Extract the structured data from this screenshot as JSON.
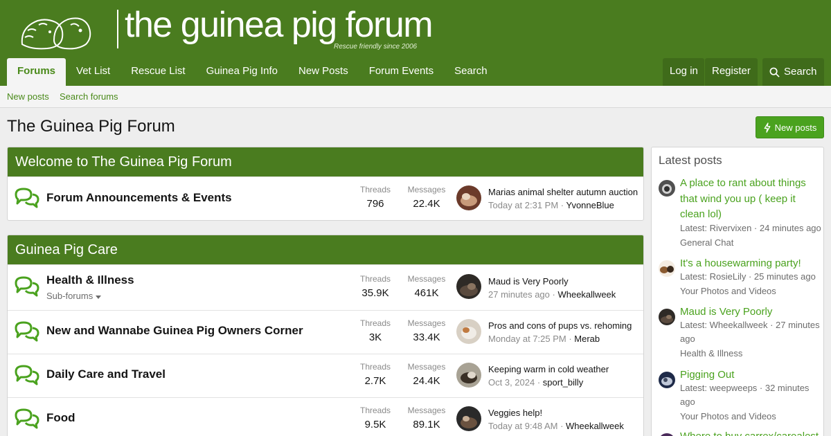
{
  "header": {
    "logo_text": "the guinea pig forum",
    "tagline": "Rescue friendly since 2006",
    "nav": [
      {
        "label": "Forums"
      },
      {
        "label": "Vet List"
      },
      {
        "label": "Rescue List"
      },
      {
        "label": "Guinea Pig Info"
      },
      {
        "label": "New Posts"
      },
      {
        "label": "Forum Events"
      },
      {
        "label": "Search"
      }
    ],
    "login": "Log in",
    "register": "Register",
    "search": "Search"
  },
  "subnav": {
    "new_posts": "New posts",
    "search_forums": "Search forums"
  },
  "page": {
    "title": "The Guinea Pig Forum",
    "new_posts_button": "New posts"
  },
  "categories": [
    {
      "title": "Welcome to The Guinea Pig Forum",
      "nodes": [
        {
          "title": "Forum Announcements & Events",
          "threads_label": "Threads",
          "threads": "796",
          "messages_label": "Messages",
          "messages": "22.4K",
          "last_title": "Marias animal shelter autumn auction",
          "last_date": "Today at 2:31 PM",
          "last_user": "YvonneBlue"
        }
      ]
    },
    {
      "title": "Guinea Pig Care",
      "nodes": [
        {
          "title": "Health & Illness",
          "subforums": "Sub-forums",
          "threads_label": "Threads",
          "threads": "35.9K",
          "messages_label": "Messages",
          "messages": "461K",
          "last_title": "Maud is Very Poorly",
          "last_date": "27 minutes ago",
          "last_user": "Wheekallweek"
        },
        {
          "title": "New and Wannabe Guinea Pig Owners Corner",
          "threads_label": "Threads",
          "threads": "3K",
          "messages_label": "Messages",
          "messages": "33.4K",
          "last_title": "Pros and cons of pups vs. rehoming",
          "last_date": "Monday at 7:25 PM",
          "last_user": "Merab"
        },
        {
          "title": "Daily Care and Travel",
          "threads_label": "Threads",
          "threads": "2.7K",
          "messages_label": "Messages",
          "messages": "24.4K",
          "last_title": "Keeping warm in cold weather",
          "last_date": "Oct 3, 2024",
          "last_user": "sport_billy"
        },
        {
          "title": "Food",
          "threads_label": "Threads",
          "threads": "9.5K",
          "messages_label": "Messages",
          "messages": "89.1K",
          "last_title": "Veggies help!",
          "last_date": "Today at 9:48 AM",
          "last_user": "Wheekallweek"
        }
      ]
    }
  ],
  "sidebar": {
    "title": "Latest posts",
    "posts": [
      {
        "title": "A place to rant about things that wind you up ( keep it clean lol)",
        "meta": "Latest: Rivervixen · 24 minutes ago",
        "forum": "General Chat"
      },
      {
        "title": "It's a housewarming party!",
        "meta": "Latest: RosieLily · 25 minutes ago",
        "forum": "Your Photos and Videos"
      },
      {
        "title": "Maud is Very Poorly",
        "meta": "Latest: Wheekallweek · 27 minutes ago",
        "forum": "Health & Illness"
      },
      {
        "title": "Pigging Out",
        "meta": "Latest: weepweeps · 32 minutes ago",
        "forum": "Your Photos and Videos"
      },
      {
        "title": "Where to buy carrex/carealest"
      }
    ]
  },
  "colors": {
    "brand_green": "#4a7c1f",
    "link_green": "#4aa21e",
    "background": "#eeeeee"
  }
}
